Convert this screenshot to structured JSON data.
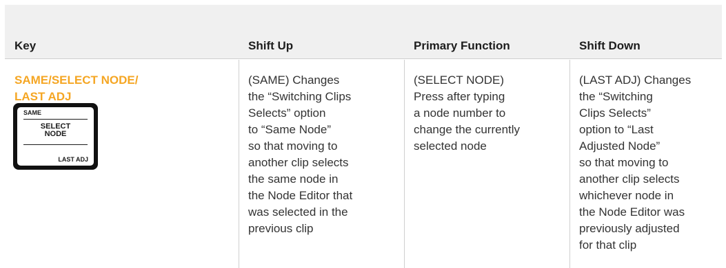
{
  "headers": {
    "key": "Key",
    "shift_up": "Shift Up",
    "primary": "Primary Function",
    "shift_down": "Shift Down"
  },
  "row": {
    "key_title_lines": [
      "SAME/SELECT NODE/",
      "LAST ADJ"
    ],
    "keycap": {
      "top": "SAME",
      "middle_lines": [
        "SELECT",
        "NODE"
      ],
      "bottom": "LAST ADJ"
    },
    "shift_up_lines": [
      "(SAME) Changes",
      "the “Switching Clips",
      "Selects” option",
      "to “Same Node”",
      "so that moving to",
      "another clip selects",
      "the same node in",
      "the Node Editor that",
      "was selected in the",
      "previous clip"
    ],
    "primary_lines": [
      "(SELECT NODE)",
      "Press after typing",
      "a node number to",
      "change the currently",
      "selected node"
    ],
    "shift_down_lines": [
      "(LAST ADJ) Changes",
      "the “Switching",
      "Clips Selects”",
      "option to “Last",
      "Adjusted Node”",
      "so that moving to",
      "another clip selects",
      "whichever node in",
      "the Node Editor was",
      "previously adjusted",
      "for that clip"
    ]
  },
  "colors": {
    "accent": "#f5a623",
    "header_bg": "#f0f0f0",
    "divider": "#cfcfcf"
  }
}
